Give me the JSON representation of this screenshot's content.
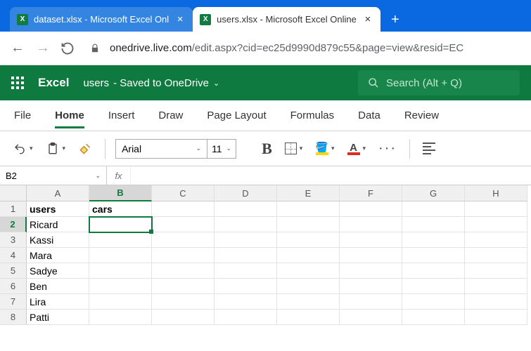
{
  "browser": {
    "tabs": [
      {
        "title": "dataset.xlsx - Microsoft Excel Onl",
        "favicon": "X"
      },
      {
        "title": "users.xlsx - Microsoft Excel Online",
        "favicon": "X"
      }
    ],
    "new_tab": "+",
    "url_host": "onedrive.live.com",
    "url_path": "/edit.aspx?cid=ec25d9990d879c55&page=view&resid=EC"
  },
  "title_bar": {
    "brand": "Excel",
    "doc_name": "users",
    "save_status": "- Saved to OneDrive",
    "search_placeholder": "Search (Alt + Q)"
  },
  "ribbon": {
    "tabs": [
      "File",
      "Home",
      "Insert",
      "Draw",
      "Page Layout",
      "Formulas",
      "Data",
      "Review"
    ],
    "active_tab": "Home",
    "font_name": "Arial",
    "font_size": "11",
    "fill_color": "#ffd600",
    "font_color": "#d93025"
  },
  "name_box": "B2",
  "fx_label": "fx",
  "columns": [
    "A",
    "B",
    "C",
    "D",
    "E",
    "F",
    "G",
    "H"
  ],
  "rows": [
    "1",
    "2",
    "3",
    "4",
    "5",
    "6",
    "7",
    "8"
  ],
  "selected_col": "B",
  "selected_row": "2",
  "cells": {
    "A1": "users",
    "B1": "cars",
    "A2": "Ricard",
    "A3": "Kassi",
    "A4": "Mara",
    "A5": "Sadye",
    "A6": "Ben",
    "A7": "Lira",
    "A8": "Patti"
  },
  "bold_cells": [
    "A1",
    "B1"
  ]
}
